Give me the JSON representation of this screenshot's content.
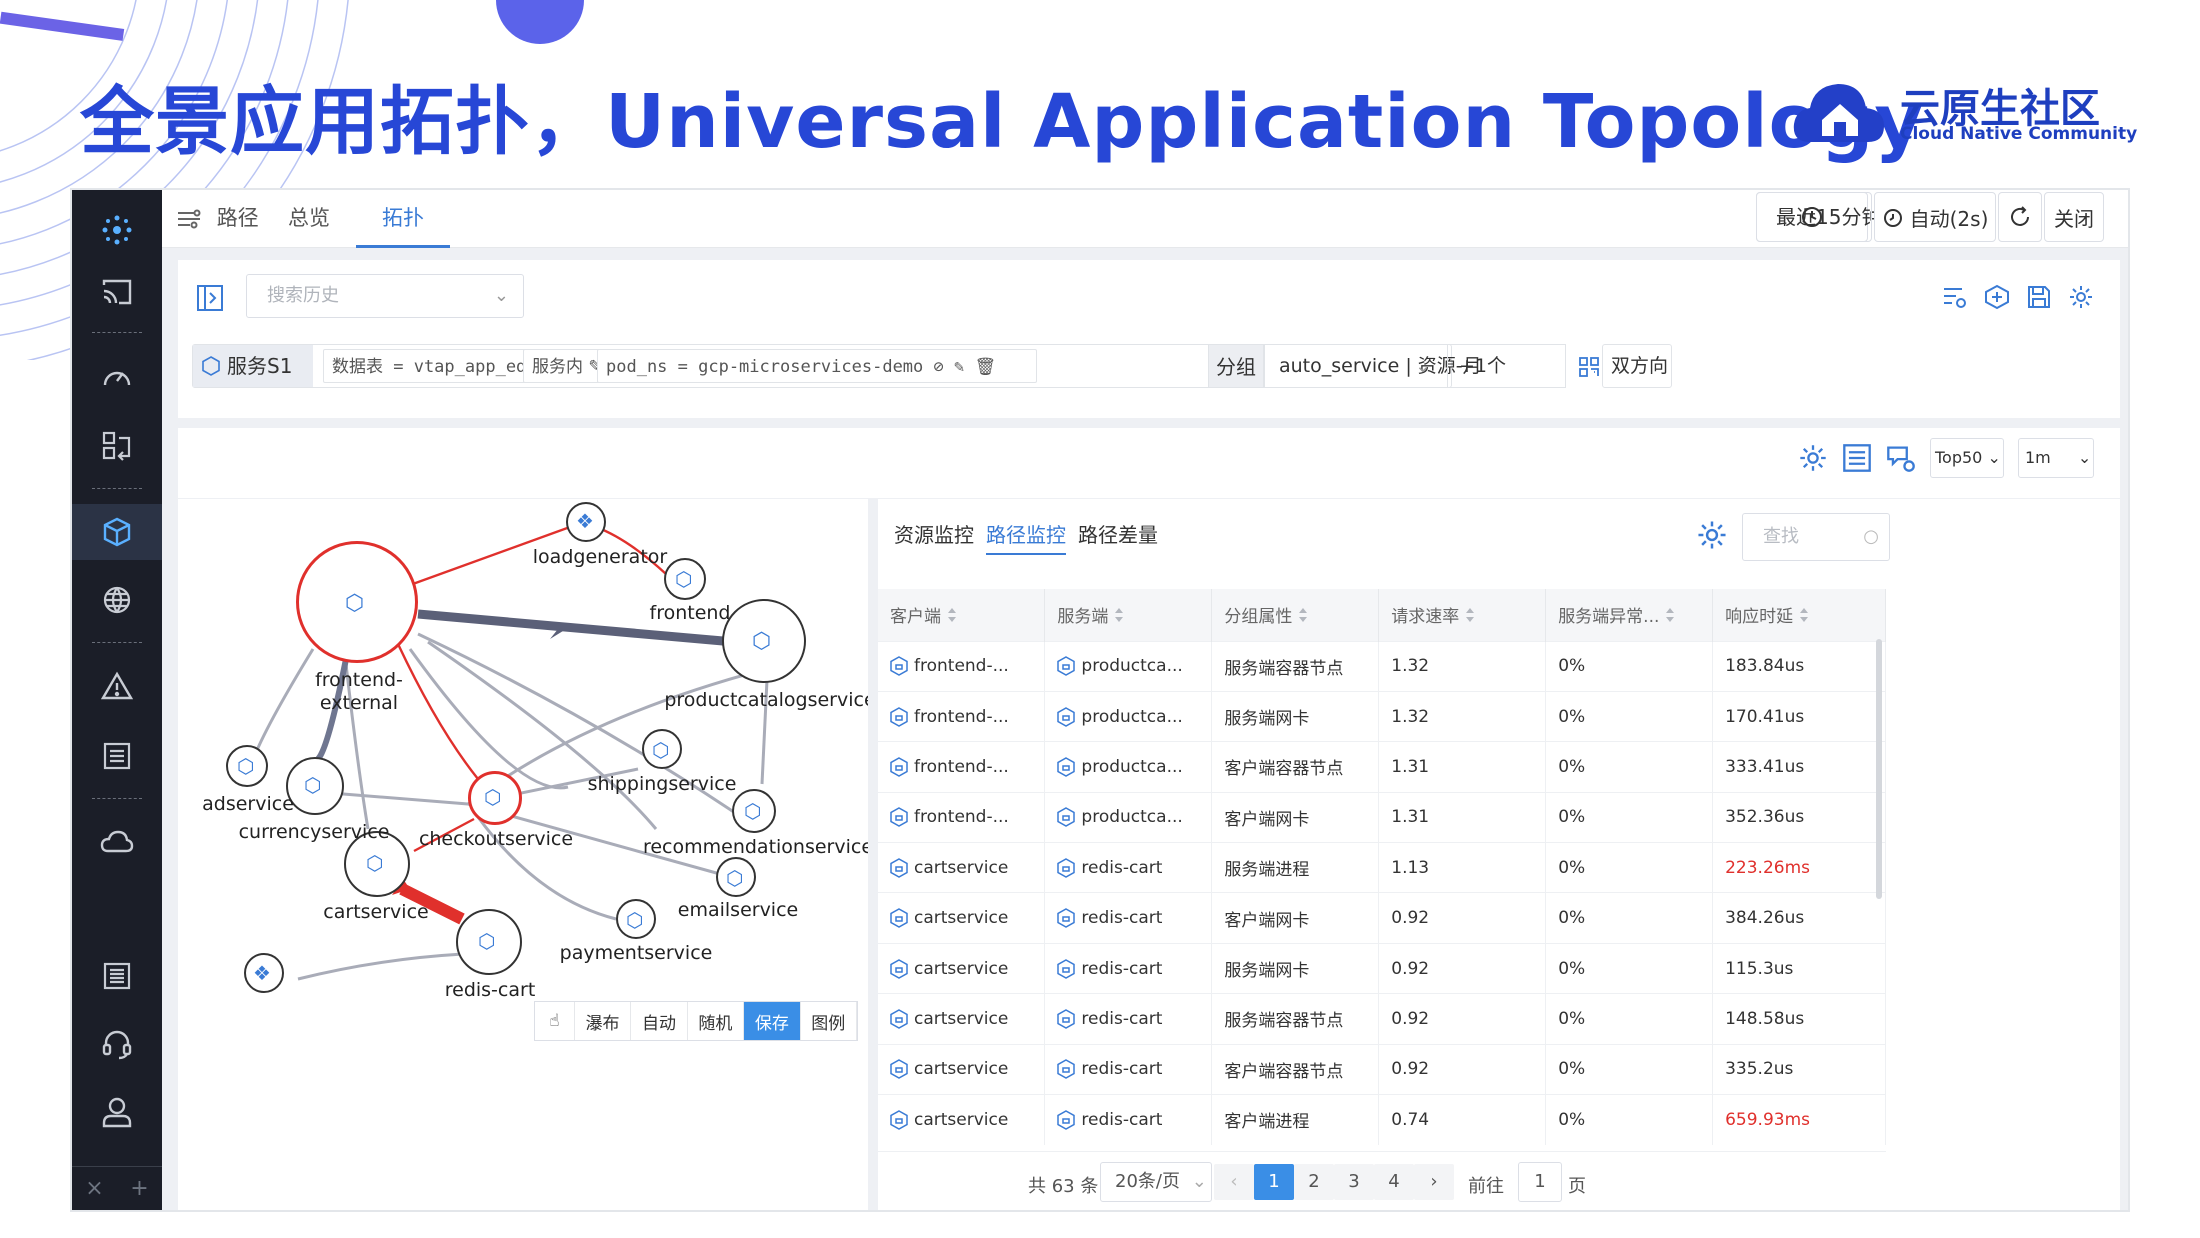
{
  "slide": {
    "headline": "全景应用拓扑，Universal Application Topology",
    "logo_cn": "云原生社区",
    "logo_en": "Cloud Native Community"
  },
  "topbar": {
    "tabs": [
      {
        "label": "路径",
        "icon": "route-icon"
      },
      {
        "label": "总览"
      },
      {
        "label": "拓扑",
        "active": true
      }
    ],
    "time_range": "最近15分钟",
    "refresh": "自动(2s)",
    "close": "关闭"
  },
  "query": {
    "history_placeholder": "搜索历史",
    "service_label": "服务S1",
    "filters": [
      "数据表 = vtap_app_edge_port",
      "服务内",
      "pod_ns = gcp-microservices-demo"
    ],
    "group_label": "分组",
    "group_value": "auto_service | 资源-月",
    "group_more": "+1个",
    "direction": "双方向"
  },
  "view_controls": {
    "topn": "Top50",
    "interval": "1m"
  },
  "graph": {
    "nodes": [
      "loadgenerator",
      "frontend",
      "frontend-external",
      "productcatalogservice",
      "adservice",
      "currencyservice",
      "shippingservice",
      "checkoutservice",
      "recommendationservice",
      "cartservice",
      "emailservice",
      "paymentservice",
      "redis-cart"
    ],
    "toolbar": [
      "瀑布",
      "自动",
      "随机",
      "保存",
      "图例"
    ],
    "toolbar_active": "保存"
  },
  "monitor": {
    "tabs": [
      "资源监控",
      "路径监控",
      "路径差量"
    ],
    "active_tab": "路径监控",
    "search_placeholder": "查找",
    "columns": [
      "客户端",
      "服务端",
      "分组属性",
      "请求速率",
      "服务端异常...",
      "响应时延"
    ],
    "rows": [
      {
        "client": "frontend-...",
        "server": "productca...",
        "group": "服务端容器节点",
        "rate": "1.32",
        "err": "0%",
        "latency": "183.84us",
        "warn": false
      },
      {
        "client": "frontend-...",
        "server": "productca...",
        "group": "服务端网卡",
        "rate": "1.32",
        "err": "0%",
        "latency": "170.41us",
        "warn": false
      },
      {
        "client": "frontend-...",
        "server": "productca...",
        "group": "客户端容器节点",
        "rate": "1.31",
        "err": "0%",
        "latency": "333.41us",
        "warn": false
      },
      {
        "client": "frontend-...",
        "server": "productca...",
        "group": "客户端网卡",
        "rate": "1.31",
        "err": "0%",
        "latency": "352.36us",
        "warn": false
      },
      {
        "client": "cartservice",
        "server": "redis-cart",
        "group": "服务端进程",
        "rate": "1.13",
        "err": "0%",
        "latency": "223.26ms",
        "warn": true
      },
      {
        "client": "cartservice",
        "server": "redis-cart",
        "group": "客户端网卡",
        "rate": "0.92",
        "err": "0%",
        "latency": "384.26us",
        "warn": false
      },
      {
        "client": "cartservice",
        "server": "redis-cart",
        "group": "服务端网卡",
        "rate": "0.92",
        "err": "0%",
        "latency": "115.3us",
        "warn": false
      },
      {
        "client": "cartservice",
        "server": "redis-cart",
        "group": "服务端容器节点",
        "rate": "0.92",
        "err": "0%",
        "latency": "148.58us",
        "warn": false
      },
      {
        "client": "cartservice",
        "server": "redis-cart",
        "group": "客户端容器节点",
        "rate": "0.92",
        "err": "0%",
        "latency": "335.2us",
        "warn": false
      },
      {
        "client": "cartservice",
        "server": "redis-cart",
        "group": "客户端进程",
        "rate": "0.74",
        "err": "0%",
        "latency": "659.93ms",
        "warn": true
      }
    ],
    "pager": {
      "total": "共 63 条",
      "page_size": "20条/页",
      "pages": [
        "1",
        "2",
        "3",
        "4"
      ],
      "current": "1",
      "goto_label": "前往",
      "goto_value": "1",
      "page_suffix": "页"
    }
  },
  "colors": {
    "accent": "#3a8ee6",
    "headline": "#2747d6",
    "alert": "#e0302c",
    "sidebar": "#1b1e28"
  }
}
